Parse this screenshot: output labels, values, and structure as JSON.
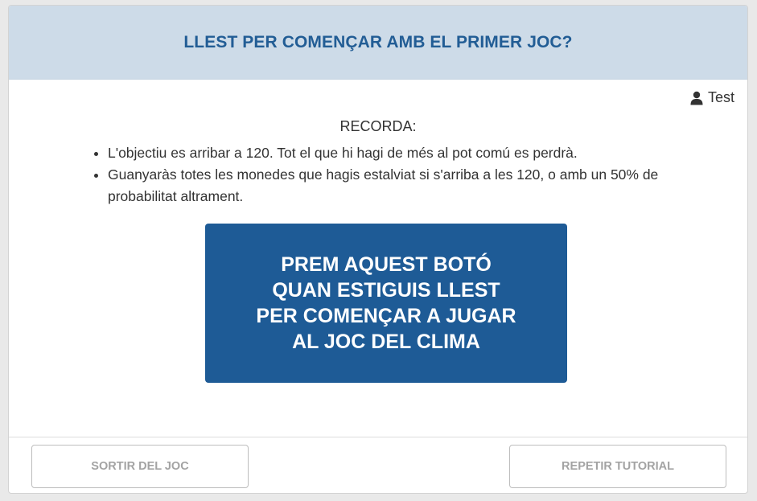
{
  "header": {
    "title": "LLEST PER COMENÇAR AMB EL PRIMER JOC?"
  },
  "user": {
    "icon": "user-icon",
    "name": "Test"
  },
  "reminder": {
    "heading": "RECORDA:",
    "items": [
      "L'objectiu es arribar a 120. Tot el que hi hagi de més al pot comú es perdrà.",
      "Guanyaràs totes les monedes que hagis estalviat si s'arriba a les 120, o amb un 50% de probabilitat altrament."
    ]
  },
  "start_button": {
    "lines": [
      "PREM AQUEST BOTÓ",
      "QUAN ESTIGUIS LLEST",
      "PER COMENÇAR A JUGAR",
      "AL JOC DEL CLIMA"
    ]
  },
  "footer": {
    "exit_label": "SORTIR DEL JOC",
    "repeat_label": "REPETIR TUTORIAL"
  },
  "colors": {
    "header_bg": "#cddbe8",
    "title": "#225d95",
    "primary_button": "#1e5b96",
    "secondary_text": "#a3a3a3"
  }
}
